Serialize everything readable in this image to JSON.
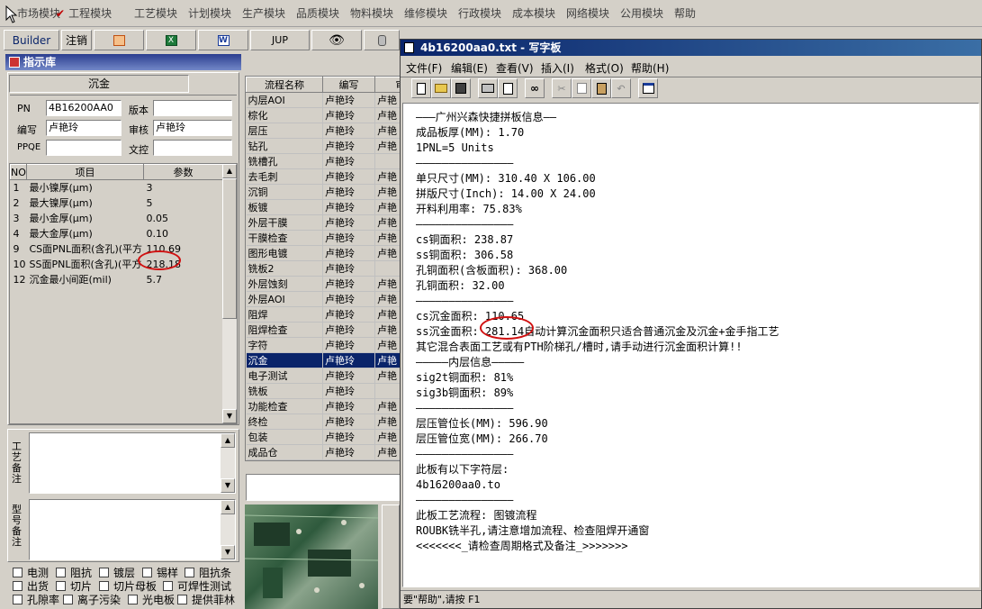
{
  "main_menu": {
    "items": [
      "市场模块",
      "工程模块",
      "工艺模块",
      "计划模块",
      "生产模块",
      "品质模块",
      "物料模块",
      "维修模块",
      "行政模块",
      "成本模块",
      "网络模块",
      "公用模块",
      "帮助"
    ],
    "checked_item": "工程模块"
  },
  "toolbar": {
    "builder": "Builder",
    "logout": "注销",
    "jump": "JUP"
  },
  "left_panel": {
    "title": "指示库",
    "process": "沉金",
    "form": {
      "pn_label": "PN",
      "pn_value": "4B16200AA0",
      "version_label": "版本",
      "version_value": "",
      "author_label": "编写",
      "author_value": "卢艳玲",
      "reviewer_label": "审核",
      "reviewer_value": "卢艳玲",
      "ppqe_label": "PPQE",
      "ppqe_value": "",
      "control_label": "文控",
      "control_value": ""
    },
    "params": {
      "headers": [
        "NO",
        "项目",
        "参数"
      ],
      "rows": [
        {
          "no": "1",
          "item": "最小镍厚(μm)",
          "value": "3"
        },
        {
          "no": "2",
          "item": "最大镍厚(μm)",
          "value": "5"
        },
        {
          "no": "3",
          "item": "最小金厚(μm)",
          "value": "0.05"
        },
        {
          "no": "4",
          "item": "最大金厚(μm)",
          "value": "0.10"
        },
        {
          "no": "9",
          "item": "CS面PNL面积(含孔)(平方",
          "value": "110.69"
        },
        {
          "no": "10",
          "item": "SS面PNL面积(含孔)(平方",
          "value": "218.18"
        },
        {
          "no": "12",
          "item": "沉金最小间距(mil)",
          "value": "5.7"
        }
      ]
    },
    "craft_note_label": "工艺备注",
    "model_note_label": "型号备注",
    "checkboxes": [
      [
        "电测",
        "阻抗",
        "镀层",
        "锡样",
        "阻抗条"
      ],
      [
        "出货",
        "切片",
        "切片母板",
        "可焊性测试"
      ],
      [
        "孔隙率",
        "离子污染",
        "光电板",
        "提供菲林"
      ]
    ]
  },
  "flow_table": {
    "headers": [
      "流程名称",
      "编写",
      "审"
    ],
    "selected": "沉金",
    "rows": [
      [
        "内层AOI",
        "卢艳玲",
        "卢艳"
      ],
      [
        "棕化",
        "卢艳玲",
        "卢艳"
      ],
      [
        "层压",
        "卢艳玲",
        "卢艳"
      ],
      [
        "钻孔",
        "卢艳玲",
        "卢艳"
      ],
      [
        "铣槽孔",
        "卢艳玲",
        ""
      ],
      [
        "去毛刺",
        "卢艳玲",
        "卢艳"
      ],
      [
        "沉铜",
        "卢艳玲",
        "卢艳"
      ],
      [
        "板镀",
        "卢艳玲",
        "卢艳"
      ],
      [
        "外层干膜",
        "卢艳玲",
        "卢艳"
      ],
      [
        "干膜检查",
        "卢艳玲",
        "卢艳"
      ],
      [
        "图形电镀",
        "卢艳玲",
        "卢艳"
      ],
      [
        "铣板2",
        "卢艳玲",
        ""
      ],
      [
        "外层蚀刻",
        "卢艳玲",
        "卢艳"
      ],
      [
        "外层AOI",
        "卢艳玲",
        "卢艳"
      ],
      [
        "阻焊",
        "卢艳玲",
        "卢艳"
      ],
      [
        "阻焊检查",
        "卢艳玲",
        "卢艳"
      ],
      [
        "字符",
        "卢艳玲",
        "卢艳"
      ],
      [
        "沉金",
        "卢艳玲",
        "卢艳"
      ],
      [
        "电子测试",
        "卢艳玲",
        "卢艳"
      ],
      [
        "铣板",
        "卢艳玲",
        ""
      ],
      [
        "功能检查",
        "卢艳玲",
        "卢艳"
      ],
      [
        "终检",
        "卢艳玲",
        "卢艳"
      ],
      [
        "包装",
        "卢艳玲",
        "卢艳"
      ],
      [
        "成品仓",
        "卢艳玲",
        "卢艳"
      ]
    ]
  },
  "wordpad": {
    "title": "4b16200aa0.txt - 写字板",
    "menu": [
      "文件(F)",
      "编辑(E)",
      "查看(V)",
      "插入(I)",
      "格式(O)",
      "帮助(H)"
    ],
    "lines": [
      "———广州兴森快捷拼板信息——",
      "成品板厚(MM): 1.70",
      "1PNL=5 Units",
      "———————————————",
      "单只尺寸(MM): 310.40 X 106.00",
      "拼版尺寸(Inch): 14.00 X 24.00",
      "开料利用率: 75.83%",
      "———————————————",
      "cs铜面积: 238.87",
      "ss铜面积: 306.58",
      "孔铜面积(含板面积): 368.00",
      "孔铜面积: 32.00",
      "———————————————",
      "cs沉金面积: 110.65",
      "ss沉金面积: 281.14自动计算沉金面积只适合普通沉金及沉金+金手指工艺",
      "其它混合表面工艺或有PTH阶梯孔/槽时,请手动进行沉金面积计算!!",
      "—————内层信息—————",
      "sig2t铜面积: 81%",
      "sig3b铜面积: 89%",
      "———————————————",
      "层压管位长(MM): 596.90",
      "层压管位宽(MM): 266.70",
      "———————————————",
      "此板有以下字符层:",
      "4b16200aa0.to",
      "———————————————",
      "此板工艺流程: 图镀流程",
      "ROUBK铣半孔,请注意增加流程、检查阻焊开通窗",
      "<<<<<<<_请检查周期格式及备注_>>>>>>>"
    ],
    "status": "要\"帮助\",请按 F1"
  },
  "colors": {
    "selection": "#0a246a",
    "annotation_circle": "#d01010",
    "title_gradient": "#0a246a"
  }
}
